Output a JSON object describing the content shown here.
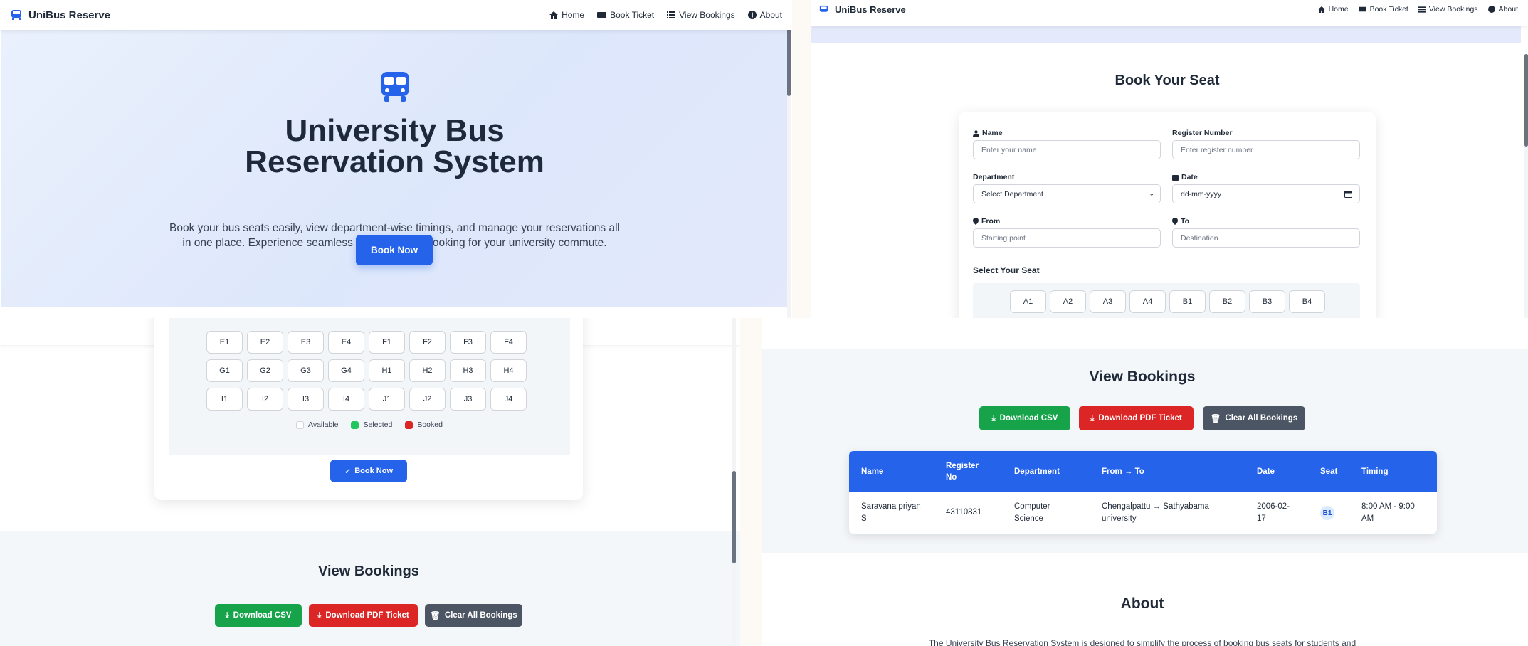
{
  "nav": {
    "brand": "UniBus Reserve",
    "home": "Home",
    "book_ticket": "Book Ticket",
    "view_bookings": "View Bookings",
    "about": "About"
  },
  "hero": {
    "title": "University Bus Reservation System",
    "description": "Book your bus seats easily, view department-wise timings, and manage your reservations all in one place. Experience seamless transportation booking for your university commute.",
    "cta": "Book Now"
  },
  "booking": {
    "heading": "Book Your Seat",
    "name_label": "Name",
    "name_placeholder": "Enter your name",
    "register_label": "Register Number",
    "register_placeholder": "Enter register number",
    "department_label": "Department",
    "department_value": "Select Department",
    "date_label": "Date",
    "date_value": "dd-mm-yyyy",
    "from_label": "From",
    "from_placeholder": "Starting point",
    "to_label": "To",
    "to_placeholder": "Destination",
    "seat_heading": "Select Your Seat",
    "seats_row_ab": [
      "A1",
      "A2",
      "A3",
      "A4",
      "B1",
      "B2",
      "B3",
      "B4"
    ],
    "seats_row_ef": [
      "E1",
      "E2",
      "E3",
      "E4",
      "F1",
      "F2",
      "F3",
      "F4"
    ],
    "seats_row_gh": [
      "G1",
      "G2",
      "G3",
      "G4",
      "H1",
      "H2",
      "H3",
      "H4"
    ],
    "seats_row_ij": [
      "I1",
      "I2",
      "I3",
      "I4",
      "J1",
      "J2",
      "J3",
      "J4"
    ],
    "legend_available": "Available",
    "legend_selected": "Selected",
    "legend_booked": "Booked",
    "submit": "Book Now"
  },
  "bookings": {
    "heading": "View Bookings",
    "download_csv": "Download CSV",
    "download_pdf": "Download PDF Ticket",
    "clear_all": "Clear All Bookings",
    "columns": [
      "Name",
      "Register No",
      "Department",
      "From → To",
      "Date",
      "Seat",
      "Timing"
    ],
    "rows": [
      {
        "name": "Saravana priyan S",
        "register": "43110831",
        "department": "Computer Science",
        "route": "Chengalpattu → Sathyabama university",
        "date": "2006-02-17",
        "seat": "B1",
        "timing": "8:00 AM - 9:00 AM"
      }
    ]
  },
  "about": {
    "heading": "About",
    "text": "The University Bus Reservation System is designed to simplify the process of booking bus seats for students and"
  },
  "colors": {
    "primary": "#2563eb",
    "success": "#16a34a",
    "danger": "#dc2626",
    "neutral": "#4b5563",
    "hero_bg": "#e2eafc"
  }
}
